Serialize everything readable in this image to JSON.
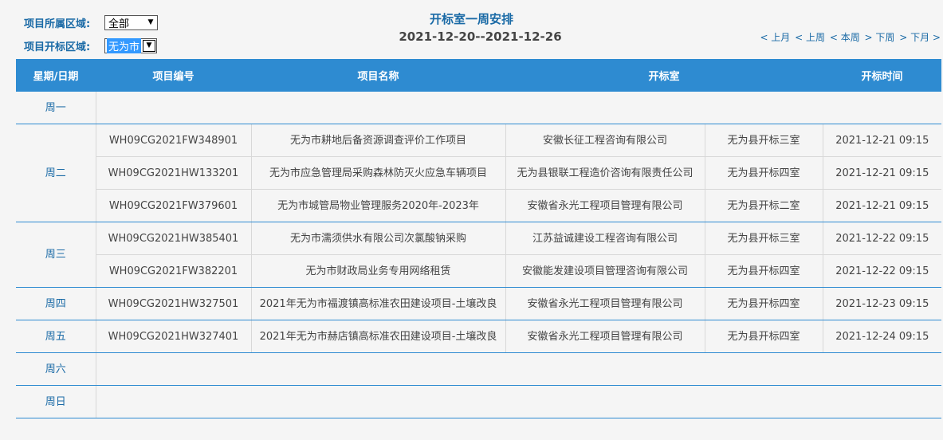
{
  "filters": {
    "region_label": "项目所属区域:",
    "region_value": "全部",
    "bid_area_label": "项目开标区域:",
    "bid_area_value": "无为市"
  },
  "header": {
    "title": "开标室一周安排",
    "date_range": "2021-12-20--2021-12-26"
  },
  "nav": {
    "prev_month": "< 上月",
    "prev_week": "< 上周",
    "this_week": "< 本周",
    "next_week": "> 下周",
    "next_month": "> 下月 >"
  },
  "table": {
    "columns": [
      "星期/日期",
      "项目编号",
      "项目名称",
      "开标室",
      "开标时间"
    ],
    "days": [
      "周一",
      "周二",
      "周三",
      "周四",
      "周五",
      "周六",
      "周日"
    ],
    "rows": [
      {
        "code": "WH09CG2021FW348901",
        "name": "无为市耕地后备资源调查评价工作项目",
        "agency": "安徽长征工程咨询有限公司",
        "room": "无为县开标三室",
        "time": "2021-12-21 09:15"
      },
      {
        "code": "WH09CG2021HW133201",
        "name": "无为市应急管理局采购森林防灭火应急车辆项目",
        "agency": "无为县银联工程造价咨询有限责任公司",
        "room": "无为县开标四室",
        "time": "2021-12-21 09:15"
      },
      {
        "code": "WH09CG2021FW379601",
        "name": "无为市城管局物业管理服务2020年-2023年",
        "agency": "安徽省永光工程项目管理有限公司",
        "room": "无为县开标二室",
        "time": "2021-12-21 09:15"
      },
      {
        "code": "WH09CG2021HW385401",
        "name": "无为市濡须供水有限公司次氯酸钠采购",
        "agency": "江苏益诚建设工程咨询有限公司",
        "room": "无为县开标三室",
        "time": "2021-12-22 09:15"
      },
      {
        "code": "WH09CG2021FW382201",
        "name": "无为市财政局业务专用网络租赁",
        "agency": "安徽能发建设项目管理咨询有限公司",
        "room": "无为县开标四室",
        "time": "2021-12-22 09:15"
      },
      {
        "code": "WH09CG2021HW327501",
        "name": "2021年无为市福渡镇高标准农田建设项目-土壤改良",
        "agency": "安徽省永光工程项目管理有限公司",
        "room": "无为县开标四室",
        "time": "2021-12-23 09:15"
      },
      {
        "code": "WH09CG2021HW327401",
        "name": "2021年无为市赫店镇高标准农田建设项目-土壤改良",
        "agency": "安徽省永光工程项目管理有限公司",
        "room": "无为县开标四室",
        "time": "2021-12-24 09:15"
      }
    ]
  }
}
